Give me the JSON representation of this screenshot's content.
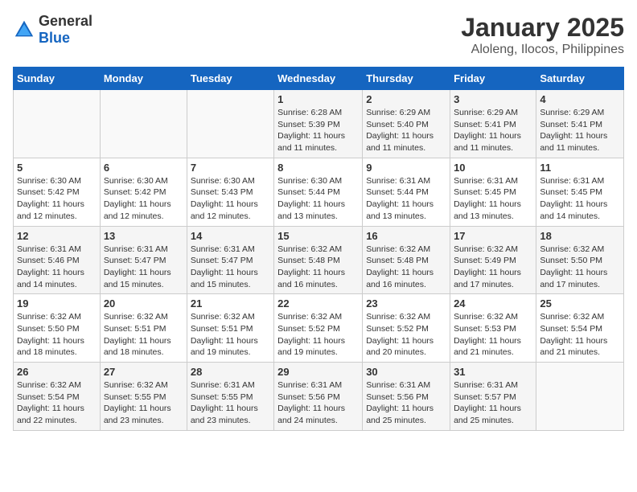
{
  "header": {
    "logo_general": "General",
    "logo_blue": "Blue",
    "title": "January 2025",
    "subtitle": "Aloleng, Ilocos, Philippines"
  },
  "calendar": {
    "days_of_week": [
      "Sunday",
      "Monday",
      "Tuesday",
      "Wednesday",
      "Thursday",
      "Friday",
      "Saturday"
    ],
    "weeks": [
      {
        "cells": [
          {
            "day": "",
            "info": ""
          },
          {
            "day": "",
            "info": ""
          },
          {
            "day": "",
            "info": ""
          },
          {
            "day": "1",
            "info": "Sunrise: 6:28 AM\nSunset: 5:39 PM\nDaylight: 11 hours\nand 11 minutes."
          },
          {
            "day": "2",
            "info": "Sunrise: 6:29 AM\nSunset: 5:40 PM\nDaylight: 11 hours\nand 11 minutes."
          },
          {
            "day": "3",
            "info": "Sunrise: 6:29 AM\nSunset: 5:41 PM\nDaylight: 11 hours\nand 11 minutes."
          },
          {
            "day": "4",
            "info": "Sunrise: 6:29 AM\nSunset: 5:41 PM\nDaylight: 11 hours\nand 11 minutes."
          }
        ]
      },
      {
        "cells": [
          {
            "day": "5",
            "info": "Sunrise: 6:30 AM\nSunset: 5:42 PM\nDaylight: 11 hours\nand 12 minutes."
          },
          {
            "day": "6",
            "info": "Sunrise: 6:30 AM\nSunset: 5:42 PM\nDaylight: 11 hours\nand 12 minutes."
          },
          {
            "day": "7",
            "info": "Sunrise: 6:30 AM\nSunset: 5:43 PM\nDaylight: 11 hours\nand 12 minutes."
          },
          {
            "day": "8",
            "info": "Sunrise: 6:30 AM\nSunset: 5:44 PM\nDaylight: 11 hours\nand 13 minutes."
          },
          {
            "day": "9",
            "info": "Sunrise: 6:31 AM\nSunset: 5:44 PM\nDaylight: 11 hours\nand 13 minutes."
          },
          {
            "day": "10",
            "info": "Sunrise: 6:31 AM\nSunset: 5:45 PM\nDaylight: 11 hours\nand 13 minutes."
          },
          {
            "day": "11",
            "info": "Sunrise: 6:31 AM\nSunset: 5:45 PM\nDaylight: 11 hours\nand 14 minutes."
          }
        ]
      },
      {
        "cells": [
          {
            "day": "12",
            "info": "Sunrise: 6:31 AM\nSunset: 5:46 PM\nDaylight: 11 hours\nand 14 minutes."
          },
          {
            "day": "13",
            "info": "Sunrise: 6:31 AM\nSunset: 5:47 PM\nDaylight: 11 hours\nand 15 minutes."
          },
          {
            "day": "14",
            "info": "Sunrise: 6:31 AM\nSunset: 5:47 PM\nDaylight: 11 hours\nand 15 minutes."
          },
          {
            "day": "15",
            "info": "Sunrise: 6:32 AM\nSunset: 5:48 PM\nDaylight: 11 hours\nand 16 minutes."
          },
          {
            "day": "16",
            "info": "Sunrise: 6:32 AM\nSunset: 5:48 PM\nDaylight: 11 hours\nand 16 minutes."
          },
          {
            "day": "17",
            "info": "Sunrise: 6:32 AM\nSunset: 5:49 PM\nDaylight: 11 hours\nand 17 minutes."
          },
          {
            "day": "18",
            "info": "Sunrise: 6:32 AM\nSunset: 5:50 PM\nDaylight: 11 hours\nand 17 minutes."
          }
        ]
      },
      {
        "cells": [
          {
            "day": "19",
            "info": "Sunrise: 6:32 AM\nSunset: 5:50 PM\nDaylight: 11 hours\nand 18 minutes."
          },
          {
            "day": "20",
            "info": "Sunrise: 6:32 AM\nSunset: 5:51 PM\nDaylight: 11 hours\nand 18 minutes."
          },
          {
            "day": "21",
            "info": "Sunrise: 6:32 AM\nSunset: 5:51 PM\nDaylight: 11 hours\nand 19 minutes."
          },
          {
            "day": "22",
            "info": "Sunrise: 6:32 AM\nSunset: 5:52 PM\nDaylight: 11 hours\nand 19 minutes."
          },
          {
            "day": "23",
            "info": "Sunrise: 6:32 AM\nSunset: 5:52 PM\nDaylight: 11 hours\nand 20 minutes."
          },
          {
            "day": "24",
            "info": "Sunrise: 6:32 AM\nSunset: 5:53 PM\nDaylight: 11 hours\nand 21 minutes."
          },
          {
            "day": "25",
            "info": "Sunrise: 6:32 AM\nSunset: 5:54 PM\nDaylight: 11 hours\nand 21 minutes."
          }
        ]
      },
      {
        "cells": [
          {
            "day": "26",
            "info": "Sunrise: 6:32 AM\nSunset: 5:54 PM\nDaylight: 11 hours\nand 22 minutes."
          },
          {
            "day": "27",
            "info": "Sunrise: 6:32 AM\nSunset: 5:55 PM\nDaylight: 11 hours\nand 23 minutes."
          },
          {
            "day": "28",
            "info": "Sunrise: 6:31 AM\nSunset: 5:55 PM\nDaylight: 11 hours\nand 23 minutes."
          },
          {
            "day": "29",
            "info": "Sunrise: 6:31 AM\nSunset: 5:56 PM\nDaylight: 11 hours\nand 24 minutes."
          },
          {
            "day": "30",
            "info": "Sunrise: 6:31 AM\nSunset: 5:56 PM\nDaylight: 11 hours\nand 25 minutes."
          },
          {
            "day": "31",
            "info": "Sunrise: 6:31 AM\nSunset: 5:57 PM\nDaylight: 11 hours\nand 25 minutes."
          },
          {
            "day": "",
            "info": ""
          }
        ]
      }
    ]
  }
}
